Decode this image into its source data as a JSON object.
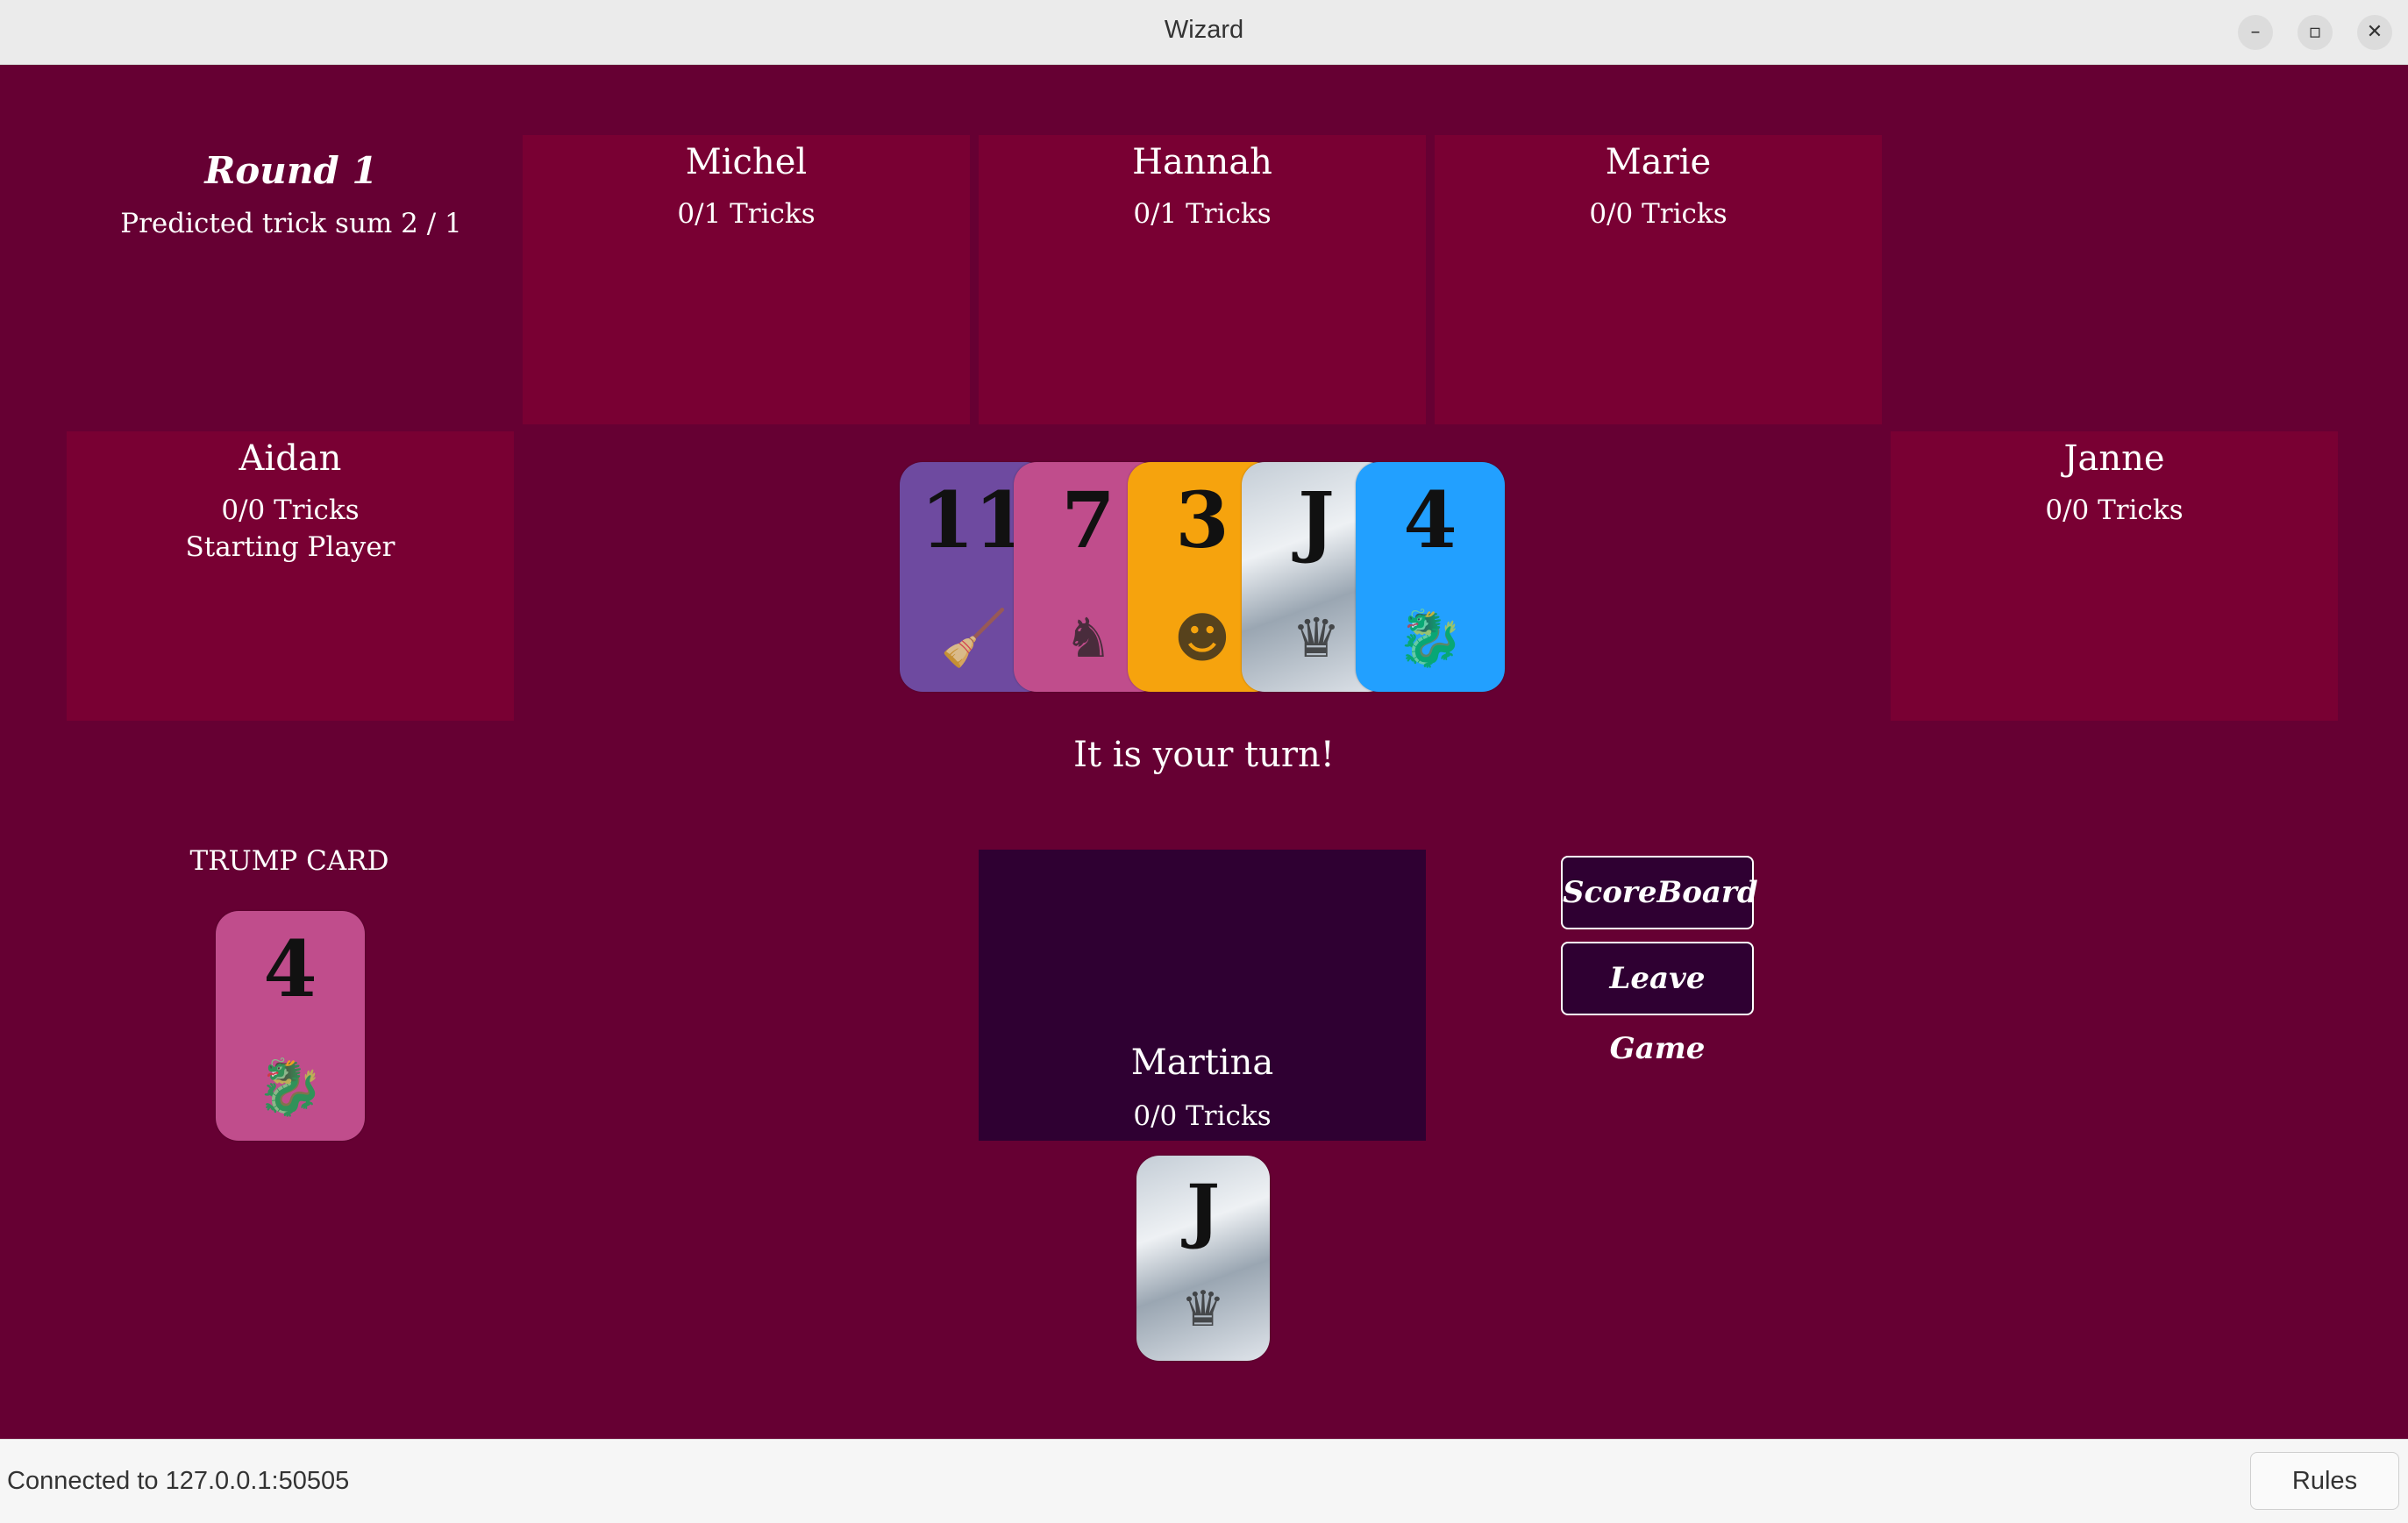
{
  "window": {
    "title": "Wizard",
    "minimize_icon": "–",
    "maximize_icon": "▫",
    "close_icon": "✕"
  },
  "round": {
    "title": "Round 1",
    "predicted": "Predicted trick sum 2 / 1"
  },
  "players": {
    "michel": {
      "name": "Michel",
      "tricks": "0/1 Tricks"
    },
    "hannah": {
      "name": "Hannah",
      "tricks": "0/1 Tricks"
    },
    "marie": {
      "name": "Marie",
      "tricks": "0/0 Tricks"
    },
    "aidan": {
      "name": "Aidan",
      "tricks": "0/0 Tricks",
      "extra": "Starting Player"
    },
    "janne": {
      "name": "Janne",
      "tricks": "0/0 Tricks"
    },
    "martina": {
      "name": "Martina",
      "tricks": "0/0 Tricks"
    }
  },
  "trick_cards": [
    {
      "value": "11",
      "color": "#6e4aa0",
      "icon": "witch-icon"
    },
    {
      "value": "7",
      "color": "#c04d8c",
      "icon": "elf-icon"
    },
    {
      "value": "3",
      "color": "#f6a30d",
      "icon": "dwarf-icon"
    },
    {
      "value": "J",
      "color": "jester",
      "icon": "jester-hat-icon"
    },
    {
      "value": "4",
      "color": "#22a0ff",
      "icon": "dragon-icon"
    }
  ],
  "turn_message": "It is your turn!",
  "trump": {
    "label": "TRUMP CARD",
    "value": "4",
    "color": "#c04d8c",
    "icon": "dragon-icon"
  },
  "hand_cards": [
    {
      "value": "J",
      "color": "jester",
      "icon": "jester-hat-icon"
    }
  ],
  "buttons": {
    "scoreboard": "ScoreBoard",
    "leave": "Leave Game"
  },
  "status": {
    "connection": "Connected to 127.0.0.1:50505",
    "rules_button": "Rules"
  }
}
